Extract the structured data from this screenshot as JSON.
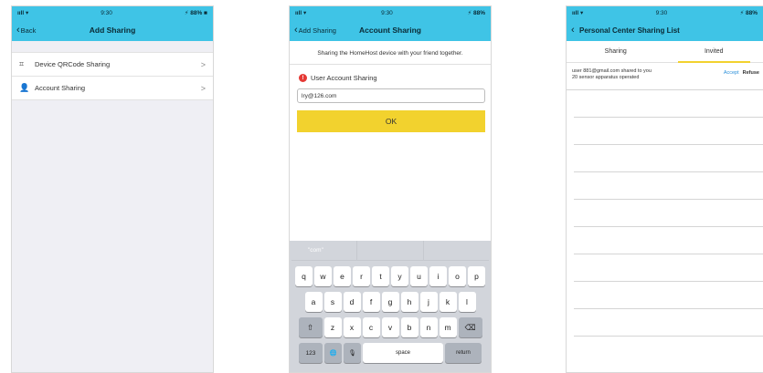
{
  "screen1": {
    "status": {
      "left": "ııll ▾",
      "mid": "9:30",
      "right": "⚡ 88% ■"
    },
    "back": "Back",
    "title": "Add Sharing",
    "items": [
      {
        "icon": "qr-code-icon",
        "label": "Device QRCode Sharing",
        "arrow": ">"
      },
      {
        "icon": "user-icon",
        "label": "Account Sharing",
        "arrow": ">"
      }
    ]
  },
  "screen2": {
    "status": {
      "left": "ııll ▾",
      "mid": "9:30",
      "right": "⚡ 88%"
    },
    "back": "Add Sharing",
    "title": "Account Sharing",
    "description": "Sharing the HomeHost device with your friend together.",
    "section_label": "User Account Sharing",
    "input_value": "lry@126.com",
    "ok_label": "OK",
    "keyboard": {
      "suggestions": [
        "\"com\"",
        "",
        ""
      ],
      "row1": [
        "q",
        "w",
        "e",
        "r",
        "t",
        "y",
        "u",
        "i",
        "o",
        "p"
      ],
      "row2": [
        "a",
        "s",
        "d",
        "f",
        "g",
        "h",
        "j",
        "k",
        "l"
      ],
      "row3": [
        "⇧",
        "z",
        "x",
        "c",
        "v",
        "b",
        "n",
        "m",
        "⌫"
      ],
      "row4": [
        "123",
        "🌐",
        "🎙",
        "space",
        "return"
      ]
    }
  },
  "screen3": {
    "status": {
      "left": "ııll ▾",
      "mid": "9:30",
      "right": "⚡ 88%"
    },
    "title": "Personal Center Sharing List",
    "tabs": [
      "Sharing",
      "Invited"
    ],
    "invite_line1": "user 881@gmail.com shared to you",
    "invite_line2": "20 sensor apparatus operated",
    "accept": "Accept",
    "refuse": "Refuse"
  }
}
